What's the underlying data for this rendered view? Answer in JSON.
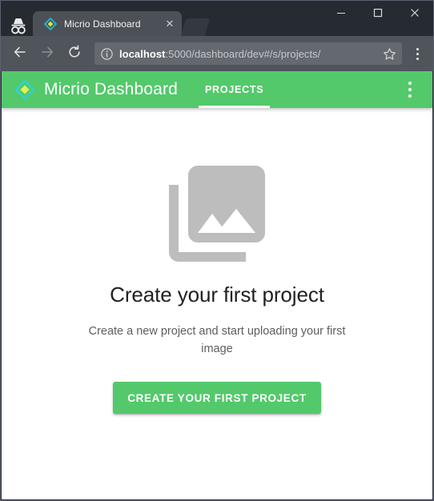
{
  "browser": {
    "mode_icon": "incognito-icon",
    "window_controls": {
      "minimize": "–",
      "maximize": "☐",
      "close": "✕"
    },
    "tab": {
      "title": "Micrio Dashboard",
      "favicon": "micrio-diamond-icon",
      "close_label": "✕"
    },
    "toolbar": {
      "back_label": "←",
      "forward_label": "→",
      "reload_label": "⟳",
      "security_icon": "info-circle-icon",
      "url_host": "localhost",
      "url_path": ":5000/dashboard/dev#/s/projects/",
      "url_full": "localhost:5000/dashboard/dev#/s/projects/",
      "bookmark_icon": "star-icon",
      "menu_icon": "three-dots-vertical-icon"
    }
  },
  "app": {
    "logo_icon": "micrio-diamond-icon",
    "title": "Micrio Dashboard",
    "tabs": [
      {
        "label": "PROJECTS",
        "active": true
      }
    ],
    "overflow_menu_icon": "three-dots-vertical-icon",
    "accent_color": "#53c96b"
  },
  "empty_state": {
    "icon": "photo-library-icon",
    "icon_color": "#bdbdbd",
    "title": "Create your first project",
    "subtitle": "Create a new project and start uploading your first image",
    "cta_label": "CREATE YOUR FIRST PROJECT"
  }
}
